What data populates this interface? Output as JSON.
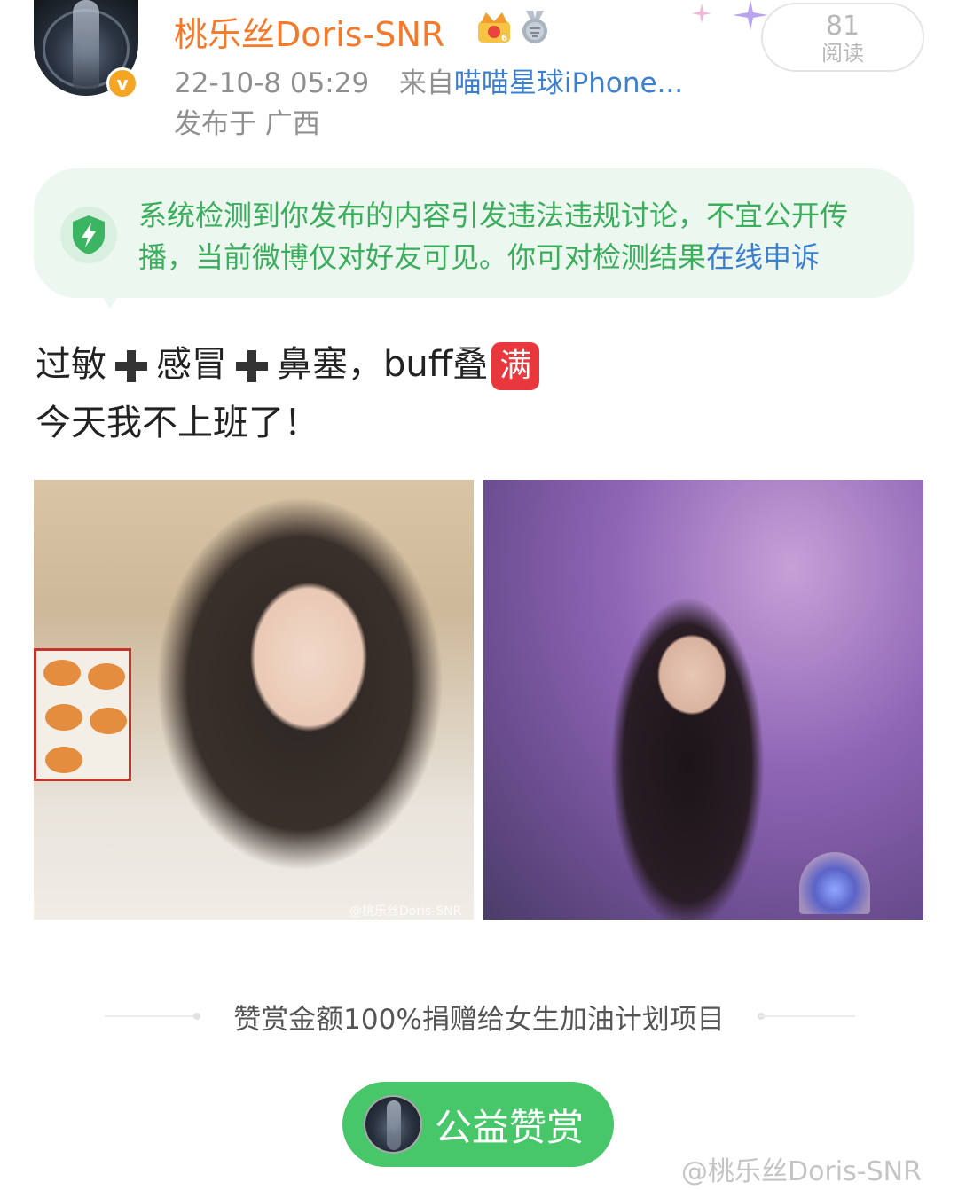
{
  "header": {
    "username": "桃乐丝Doris-SNR",
    "timestamp": "22-10-8 05:29",
    "source_prefix": "来自",
    "source_device": "喵喵星球iPhone...",
    "location": "发布于 广西",
    "read_count": "81",
    "read_label": "阅读",
    "username_color": "#f5792a",
    "verified_badge_symbol": "v"
  },
  "notice": {
    "message": "系统检测到你发布的内容引发违法违规讨论，不宜公开传播，当前微博仅对好友可见。你可对检测结果",
    "appeal_link": "在线申诉",
    "text_color": "#3aae5b",
    "link_color": "#3d7fcf"
  },
  "post": {
    "line1_part1": "过敏",
    "line1_part2": "感冒",
    "line1_part3": "鼻塞，buff叠",
    "line1_emoji": "满",
    "line2": "今天我不上班了！"
  },
  "photos": {
    "left_watermark": "@桃乐丝Doris-SNR"
  },
  "reward": {
    "description": "赞赏金额100%捐赠给女生加油计划项目",
    "button_label": "公益赞赏",
    "button_color": "#47c76a"
  },
  "footer": {
    "watermark": "@桃乐丝Doris-SNR"
  }
}
